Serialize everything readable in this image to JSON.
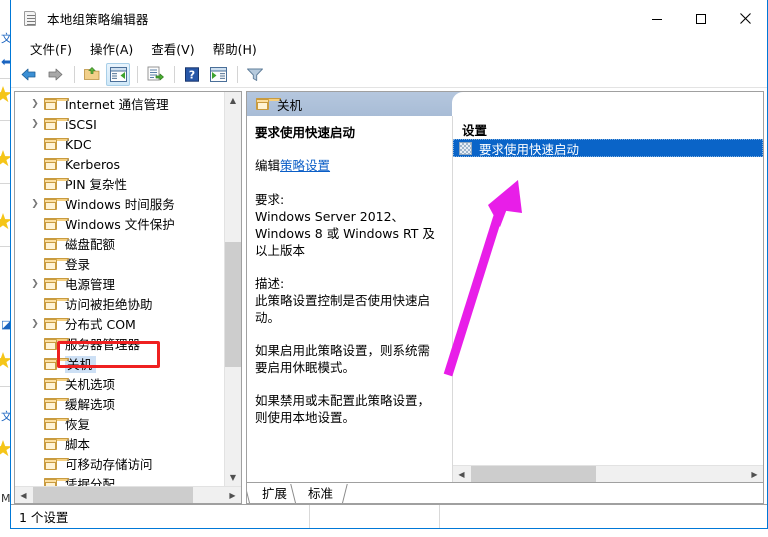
{
  "window": {
    "title": "本地组策略编辑器",
    "app_icon": "policy-scroll-icon",
    "controls": {
      "minimize": "minimize-icon",
      "maximize": "maximize-icon",
      "close": "close-icon"
    }
  },
  "menubar": {
    "items": [
      {
        "label": "文件(F)",
        "name": "menu-file"
      },
      {
        "label": "操作(A)",
        "name": "menu-action"
      },
      {
        "label": "查看(V)",
        "name": "menu-view"
      },
      {
        "label": "帮助(H)",
        "name": "menu-help"
      }
    ]
  },
  "toolbar": {
    "buttons": [
      {
        "name": "back-button",
        "icon": "back-arrow-icon"
      },
      {
        "name": "forward-button",
        "icon": "forward-arrow-icon"
      },
      {
        "name": "up-one-level-button",
        "icon": "folder-up-icon"
      },
      {
        "name": "show-hide-console-tree-button",
        "icon": "console-tree-icon",
        "active": true
      },
      {
        "name": "export-list-button",
        "icon": "export-list-icon"
      },
      {
        "name": "help-button",
        "icon": "help-question-icon"
      },
      {
        "name": "show-hide-action-pane-button",
        "icon": "action-pane-icon"
      },
      {
        "name": "filter-button",
        "icon": "filter-funnel-icon"
      }
    ]
  },
  "tree": {
    "items": [
      {
        "label": "Internet 通信管理",
        "expandable": true,
        "selected": false
      },
      {
        "label": "iSCSI",
        "expandable": true,
        "selected": false
      },
      {
        "label": "KDC",
        "expandable": false,
        "selected": false
      },
      {
        "label": "Kerberos",
        "expandable": false,
        "selected": false
      },
      {
        "label": "PIN 复杂性",
        "expandable": false,
        "selected": false
      },
      {
        "label": "Windows 时间服务",
        "expandable": true,
        "selected": false
      },
      {
        "label": "Windows 文件保护",
        "expandable": false,
        "selected": false
      },
      {
        "label": "磁盘配额",
        "expandable": false,
        "selected": false
      },
      {
        "label": "登录",
        "expandable": false,
        "selected": false
      },
      {
        "label": "电源管理",
        "expandable": true,
        "selected": false
      },
      {
        "label": "访问被拒绝协助",
        "expandable": false,
        "selected": false
      },
      {
        "label": "分布式 COM",
        "expandable": true,
        "selected": false
      },
      {
        "label": "服务器管理器",
        "expandable": false,
        "selected": false
      },
      {
        "label": "关机",
        "expandable": false,
        "selected": true
      },
      {
        "label": "关机选项",
        "expandable": false,
        "selected": false
      },
      {
        "label": "缓解选项",
        "expandable": false,
        "selected": false
      },
      {
        "label": "恢复",
        "expandable": false,
        "selected": false
      },
      {
        "label": "脚本",
        "expandable": false,
        "selected": false
      },
      {
        "label": "可移动存储访问",
        "expandable": false,
        "selected": false
      },
      {
        "label": "凭据分配",
        "expandable": false,
        "selected": false
      }
    ]
  },
  "detail": {
    "header_title": "关机",
    "header_icon": "folder-icon",
    "policy_title": "要求使用快速启动",
    "edit_prefix": "编辑",
    "edit_link": "策略设置",
    "requirement_label": "要求:",
    "requirement_text": "Windows Server 2012、Windows 8 或 Windows RT 及以上版本",
    "description_label": "描述:",
    "description_paragraphs": [
      "此策略设置控制是否使用快速启动。",
      "如果启用此策略设置，则系统需要启用休眠模式。",
      "如果禁用或未配置此策略设置，则使用本地设置。"
    ]
  },
  "settings_list": {
    "header": "设置",
    "rows": [
      {
        "label": "要求使用快速启动",
        "icon": "policy-setting-icon",
        "selected": true
      }
    ]
  },
  "tabs": [
    {
      "label": "扩展",
      "name": "tab-extended",
      "active": true
    },
    {
      "label": "标准",
      "name": "tab-standard",
      "active": false
    }
  ],
  "statusbar": {
    "count_text": "1 个设置"
  },
  "annotations": {
    "highlight_rect_color": "#ef2020",
    "arrow_color": "#e81ee8",
    "highlight_target": "关机",
    "arrow_target": "要求使用快速启动"
  }
}
